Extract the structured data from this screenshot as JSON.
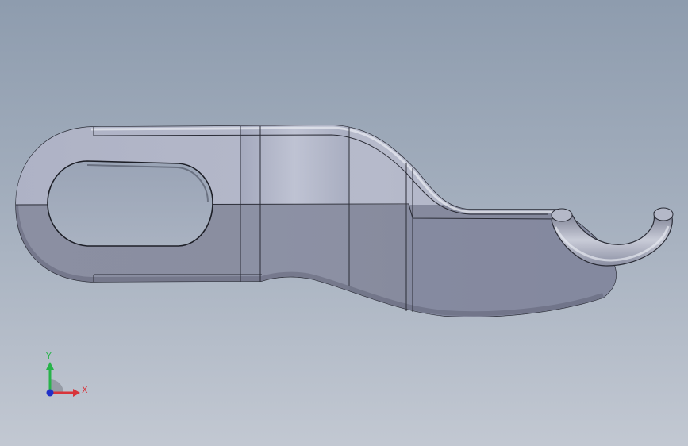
{
  "viewport": {
    "background_top": "#8e9cae",
    "background_bottom": "#c2c8d2",
    "model": "hook-bracket-part"
  },
  "triad": {
    "y_label": "Y",
    "x_label": "X",
    "y_color": "#27b34a",
    "x_color": "#d8343a",
    "z_color": "#2030c8"
  }
}
